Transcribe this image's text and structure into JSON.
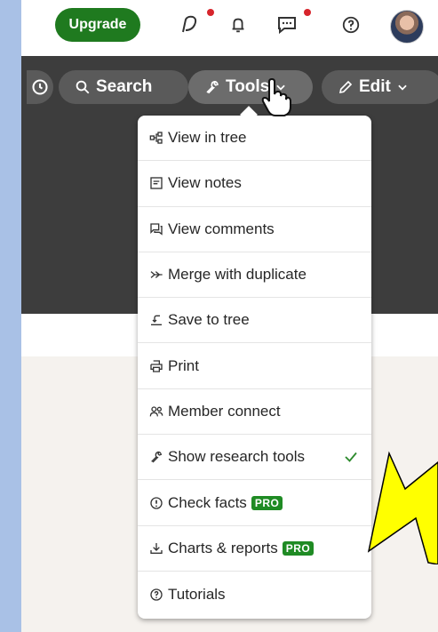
{
  "topnav": {
    "upgrade_label": "Upgrade",
    "icons": [
      "activity-icon",
      "bell-icon",
      "messages-icon",
      "help-icon"
    ],
    "notification_color": "#d7252c",
    "upgrade_color": "#1f7a1f"
  },
  "toolbar": {
    "search_label": "Search",
    "tools_label": "Tools",
    "edit_label": "Edit"
  },
  "menu": {
    "items": [
      {
        "label": "View in tree",
        "icon": "tree-icon"
      },
      {
        "label": "View notes",
        "icon": "notes-icon"
      },
      {
        "label": "View comments",
        "icon": "comments-icon"
      },
      {
        "label": "Merge with duplicate",
        "icon": "merge-icon"
      },
      {
        "label": "Save to tree",
        "icon": "save-icon"
      },
      {
        "label": "Print",
        "icon": "print-icon"
      },
      {
        "label": "Member connect",
        "icon": "members-icon"
      },
      {
        "label": "Show research tools",
        "icon": "wrench-icon",
        "checked": true
      },
      {
        "label": "Check facts",
        "icon": "alert-icon",
        "badge": "PRO"
      },
      {
        "label": "Charts & reports",
        "icon": "download-icon",
        "badge": "PRO"
      },
      {
        "label": "Tutorials",
        "icon": "help-icon"
      }
    ]
  },
  "colors": {
    "toolbar_bg": "#3d3d3d",
    "pro_badge": "#1f8b24",
    "check": "#2e8b2e",
    "annotation_arrow": "#ffff00"
  }
}
